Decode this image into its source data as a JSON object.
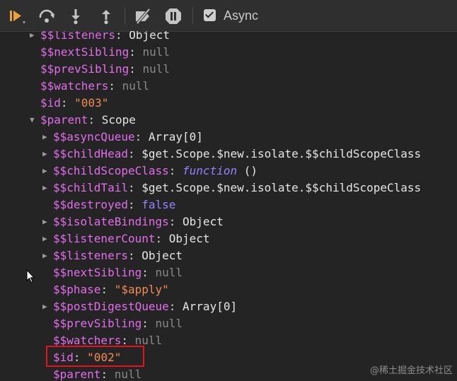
{
  "toolbar": {
    "icons": [
      "resume-icon",
      "step-over-icon",
      "step-into-icon",
      "step-out-icon",
      "deactivate-breakpoints-icon",
      "pause-on-exceptions-icon"
    ],
    "async_checked": true,
    "async_label": "Async"
  },
  "rows": [
    {
      "key": "$$listeners",
      "value": "Object",
      "vtype": "obj",
      "arrow": "collapsed",
      "depth": 0
    },
    {
      "key": "$$nextSibling",
      "value": "null",
      "vtype": "null",
      "arrow": "none",
      "depth": 0
    },
    {
      "key": "$$prevSibling",
      "value": "null",
      "vtype": "null",
      "arrow": "none",
      "depth": 0
    },
    {
      "key": "$$watchers",
      "value": "null",
      "vtype": "null",
      "arrow": "none",
      "depth": 0
    },
    {
      "key": "$id",
      "value": "\"003\"",
      "vtype": "str",
      "arrow": "none",
      "depth": 0
    },
    {
      "key": "$parent",
      "value": "Scope",
      "vtype": "obj",
      "arrow": "expanded",
      "depth": 0
    },
    {
      "key": "$$asyncQueue",
      "value": "Array[0]",
      "vtype": "obj",
      "arrow": "collapsed",
      "depth": 1
    },
    {
      "key": "$$childHead",
      "value": "$get.Scope.$new.isolate.$$childScopeClass",
      "vtype": "obj",
      "arrow": "collapsed",
      "depth": 1
    },
    {
      "key": "$$childScopeClass",
      "value": "function",
      "suffix": " ()",
      "vtype": "fn",
      "arrow": "collapsed",
      "depth": 1
    },
    {
      "key": "$$childTail",
      "value": "$get.Scope.$new.isolate.$$childScopeClass",
      "vtype": "obj",
      "arrow": "collapsed",
      "depth": 1
    },
    {
      "key": "$$destroyed",
      "value": "false",
      "vtype": "bool",
      "arrow": "none",
      "depth": 1
    },
    {
      "key": "$$isolateBindings",
      "value": "Object",
      "vtype": "obj",
      "arrow": "collapsed",
      "depth": 1
    },
    {
      "key": "$$listenerCount",
      "value": "Object",
      "vtype": "obj",
      "arrow": "collapsed",
      "depth": 1
    },
    {
      "key": "$$listeners",
      "value": "Object",
      "vtype": "obj",
      "arrow": "collapsed",
      "depth": 1
    },
    {
      "key": "$$nextSibling",
      "value": "null",
      "vtype": "null",
      "arrow": "none",
      "depth": 1
    },
    {
      "key": "$$phase",
      "value": "\"$apply\"",
      "vtype": "str",
      "arrow": "none",
      "depth": 1
    },
    {
      "key": "$$postDigestQueue",
      "value": "Array[0]",
      "vtype": "obj",
      "arrow": "collapsed",
      "depth": 1
    },
    {
      "key": "$$prevSibling",
      "value": "null",
      "vtype": "null",
      "arrow": "none",
      "depth": 1
    },
    {
      "key": "$$watchers",
      "value": "null",
      "vtype": "null",
      "arrow": "none",
      "depth": 1
    },
    {
      "key": "$id",
      "value": "\"002\"",
      "vtype": "str",
      "arrow": "none",
      "depth": 1,
      "highlighted": true
    },
    {
      "key": "$parent",
      "value": "null",
      "vtype": "null",
      "arrow": "none",
      "depth": 1
    }
  ],
  "watermark": "@稀土掘金技术社区"
}
